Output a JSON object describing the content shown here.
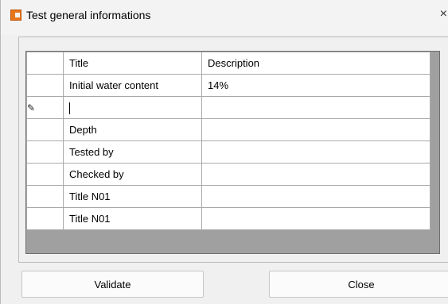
{
  "window": {
    "title": "Test general informations",
    "close_glyph": "×",
    "icon": "app-logo-icon",
    "icon_color": "#e8761a"
  },
  "grid": {
    "columns": [
      "Title",
      "Description"
    ],
    "rows": [
      {
        "marker": "",
        "title": "Initial water content",
        "description": "14%"
      },
      {
        "marker": "pencil-icon",
        "title": "",
        "description": ""
      },
      {
        "marker": "",
        "title": "Depth",
        "description": ""
      },
      {
        "marker": "",
        "title": "Tested by",
        "description": ""
      },
      {
        "marker": "",
        "title": "Checked by",
        "description": ""
      },
      {
        "marker": "",
        "title": "Title N01",
        "description": ""
      },
      {
        "marker": "",
        "title": "Title N01",
        "description": ""
      }
    ]
  },
  "buttons": {
    "validate": "Validate",
    "close": "Close"
  }
}
